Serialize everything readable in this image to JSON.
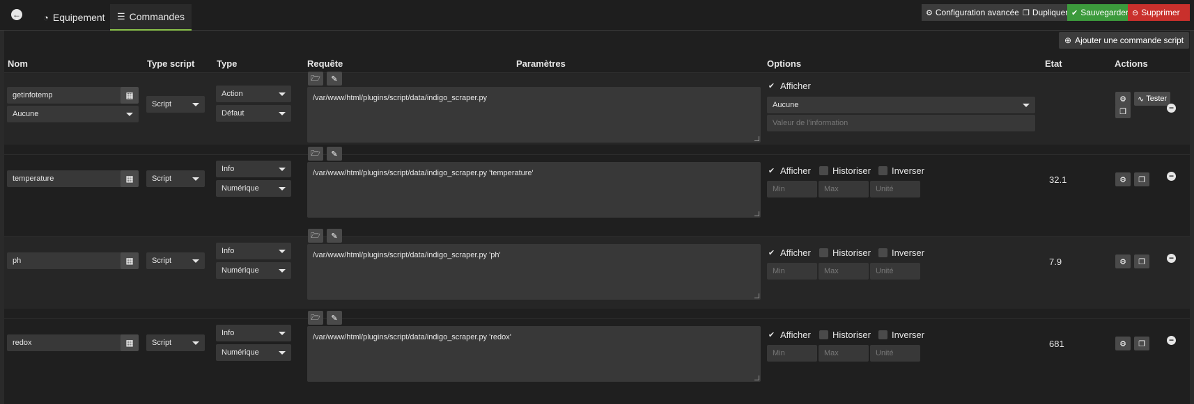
{
  "tabs": {
    "equipement": "Equipement",
    "commandes": "Commandes"
  },
  "toolbar": {
    "config": "Configuration avancée",
    "dupliquer": "Dupliquer",
    "sauvegarder": "Sauvegarder",
    "supprimer": "Supprimer",
    "ajouter": "Ajouter une commande script"
  },
  "columns": {
    "nom": "Nom",
    "type_script": "Type script",
    "type": "Type",
    "requete": "Requête",
    "parametres": "Paramètres",
    "options": "Options",
    "etat": "Etat",
    "actions": "Actions"
  },
  "labels": {
    "afficher": "Afficher",
    "historiser": "Historiser",
    "inverser": "Inverser",
    "min": "Min",
    "max": "Max",
    "unite": "Unité",
    "tester": "Tester",
    "valeur_info": "Valeur de l'information"
  },
  "rows": [
    {
      "name": "getinfotemp",
      "link": "Aucune",
      "script_type": "Script",
      "type": "Action",
      "subtype": "Défaut",
      "request": "/var/www/html/plugins/script/data/indigo_scraper.py",
      "option_select": "Aucune",
      "state": ""
    },
    {
      "name": "temperature",
      "script_type": "Script",
      "type": "Info",
      "subtype": "Numérique",
      "request": "/var/www/html/plugins/script/data/indigo_scraper.py 'temperature'",
      "state": "32.1"
    },
    {
      "name": "ph",
      "script_type": "Script",
      "type": "Info",
      "subtype": "Numérique",
      "request": "/var/www/html/plugins/script/data/indigo_scraper.py 'ph'",
      "state": "7.9"
    },
    {
      "name": "redox",
      "script_type": "Script",
      "type": "Info",
      "subtype": "Numérique",
      "request": "/var/www/html/plugins/script/data/indigo_scraper.py 'redox'",
      "state": "681"
    }
  ]
}
